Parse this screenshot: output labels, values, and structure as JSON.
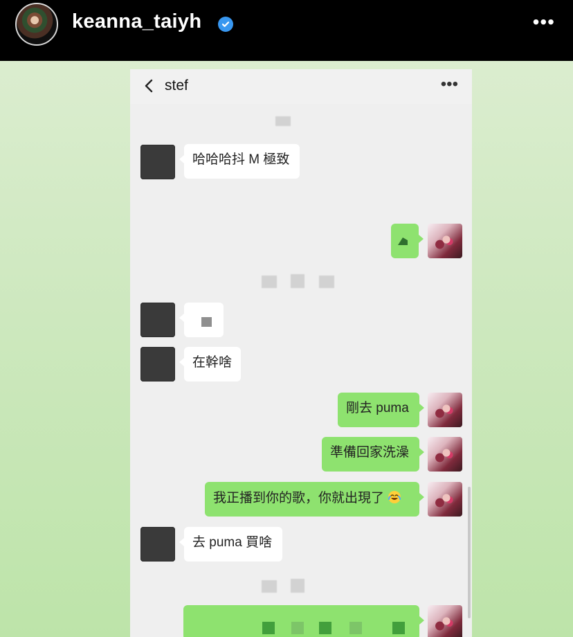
{
  "story": {
    "username": "keanna_taiyh",
    "more_label": "•••"
  },
  "chat": {
    "title": "stef",
    "more_label": "•••",
    "messages": [
      {
        "side": "left",
        "text": "哈哈哈抖 M 極致"
      },
      {
        "side": "right",
        "text": ""
      },
      {
        "side": "left",
        "text": ""
      },
      {
        "side": "left",
        "text": "在幹啥"
      },
      {
        "side": "right",
        "text": "剛去 puma"
      },
      {
        "side": "right",
        "text": "準備回家洗澡"
      },
      {
        "side": "right",
        "text": "我正播到你的歌，你就出現了"
      },
      {
        "side": "left",
        "text": "去 puma 買啥"
      },
      {
        "side": "right",
        "text": ""
      }
    ]
  },
  "colors": {
    "story_bg_top": "#dbedcf",
    "story_bg_bottom": "#bde4a9",
    "right_bubble": "#8ee26f",
    "left_bubble": "#ffffff",
    "verified_blue": "#3897f0"
  }
}
